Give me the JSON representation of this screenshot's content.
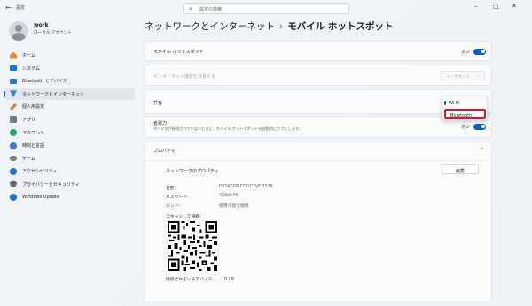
{
  "window": {
    "app_title": "設定",
    "back_glyph": "←",
    "controls": [
      "–",
      "□",
      "✕"
    ]
  },
  "search": {
    "placeholder": "設定の検索"
  },
  "profile": {
    "name": "work",
    "account_type": "ローカル アカウント"
  },
  "sidebar": {
    "items": [
      {
        "label": "ホーム",
        "icon": "home-icon",
        "color": "#e88a3c"
      },
      {
        "label": "システム",
        "icon": "system-icon",
        "color": "#0078d4"
      },
      {
        "label": "Bluetooth とデバイス",
        "icon": "bluetooth-icon",
        "color": "#2f6fd0"
      },
      {
        "label": "ネットワークとインターネット",
        "icon": "network-icon",
        "color": "#3a7ed6",
        "active": true
      },
      {
        "label": "個人用設定",
        "icon": "personalization-icon",
        "color": "#d9823b"
      },
      {
        "label": "アプリ",
        "icon": "apps-icon",
        "color": "#6b7a8c"
      },
      {
        "label": "アカウント",
        "icon": "accounts-icon",
        "color": "#2aa36b"
      },
      {
        "label": "時刻と言語",
        "icon": "time-language-icon",
        "color": "#3b7bd6"
      },
      {
        "label": "ゲーム",
        "icon": "gaming-icon",
        "color": "#7a7f87"
      },
      {
        "label": "アクセシビリティ",
        "icon": "accessibility-icon",
        "color": "#2b6fc9"
      },
      {
        "label": "プライバシーとセキュリティ",
        "icon": "privacy-icon",
        "color": "#5f6670"
      },
      {
        "label": "Windows Update",
        "icon": "windows-update-icon",
        "color": "#1a73d1"
      }
    ]
  },
  "breadcrumb": {
    "parent": "ネットワークとインターネット",
    "separator": "›",
    "current": "モバイル ホットスポット"
  },
  "hotspot": {
    "label": "モバイル ホットスポット",
    "state": "オン"
  },
  "share_from": {
    "label": "インターネット接続を共有する",
    "value": "イーサネット"
  },
  "share_over": {
    "label": "共有",
    "options": [
      "Wi-Fi",
      "Bluetooth"
    ],
    "highlighted": "Bluetooth"
  },
  "power_saving": {
    "label": "省電力",
    "description": "デバイスが接続されていないときに、モバイル ホットスポットを自動的にオフにします。",
    "state": "オン"
  },
  "properties": {
    "header": "プロパティ",
    "network_props_title": "ネットワークのプロパティ",
    "edit_label": "編集",
    "rows": [
      {
        "key": "名前:",
        "value": "DESKTOP-CDOC2VF 3576"
      },
      {
        "key": "パスワード:",
        "value": "!92b8:*3"
      },
      {
        "key": "バンド:",
        "value": "使用可能な接続"
      }
    ],
    "scan_label": "スキャンして接続:",
    "connected_label": "接続されているデバイス:",
    "connected_value": "0 / 8"
  },
  "colors": {
    "accent": "#005fb8",
    "highlight_border": "#d11b2b"
  }
}
